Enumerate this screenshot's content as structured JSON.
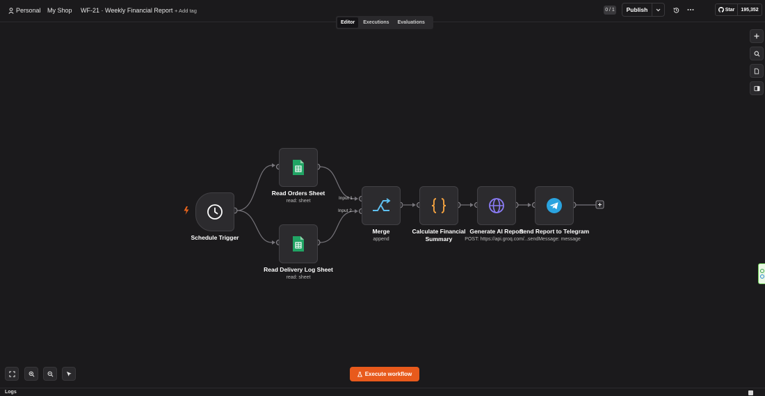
{
  "header": {
    "owner": "Personal",
    "project": "My Shop",
    "workflow_name": "WF-21 · Weekly Financial Report",
    "add_tag": "+ Add tag",
    "counter": "0 / 1",
    "publish_label": "Publish",
    "github_star_label": "Star",
    "github_star_count": "195,352"
  },
  "tabs": [
    {
      "label": "Editor",
      "active": true
    },
    {
      "label": "Executions",
      "active": false
    },
    {
      "label": "Evaluations",
      "active": false
    }
  ],
  "nodes": {
    "schedule_trigger": {
      "label": "Schedule Trigger"
    },
    "read_orders": {
      "label": "Read Orders Sheet",
      "sub": "read: sheet"
    },
    "read_delivery": {
      "label": "Read Delivery Log Sheet",
      "sub": "read: sheet"
    },
    "merge": {
      "label": "Merge",
      "sub": "append",
      "input1": "Input 1",
      "input2": "Input 2"
    },
    "calculate": {
      "label_line1": "Calculate Financial",
      "label_line2": "Summary"
    },
    "generate": {
      "label": "Generate AI Report",
      "sub": "POST: https://api.groq.com/..."
    },
    "telegram": {
      "label": "Send Report to Telegram",
      "sub": "sendMessage: message"
    }
  },
  "execute_label": "Execute workflow",
  "logs_label": "Logs",
  "colors": {
    "background": "#1b1a1c",
    "node_bg": "#2c2b2e",
    "accent_orange": "#e85a1c",
    "sheets_green": "#21a464",
    "merge_blue": "#5fc0f0",
    "code_orange": "#f0a040",
    "http_purple": "#8b7cf6",
    "telegram_blue": "#2aa3df"
  }
}
